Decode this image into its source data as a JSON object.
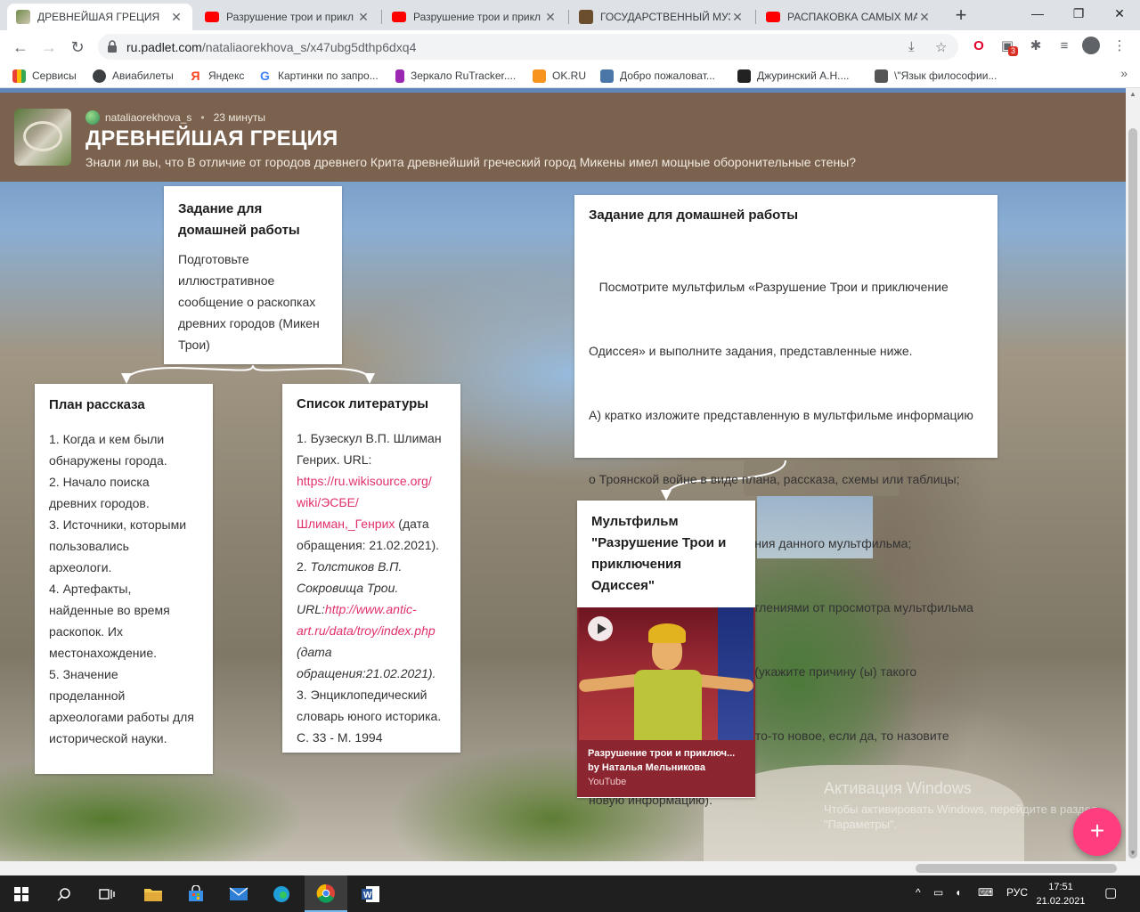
{
  "browser": {
    "tabs": [
      {
        "title": "ДРЕВНЕЙШАЯ ГРЕЦИЯ",
        "favicon": "padlet-thumb-icon",
        "color": "#8a7a5c",
        "active": true
      },
      {
        "title": "Разрушение трои и прикл",
        "favicon": "youtube-icon",
        "color": "#ff0000",
        "active": false
      },
      {
        "title": "Разрушение трои и прикл",
        "favicon": "youtube-icon",
        "color": "#ff0000",
        "active": false
      },
      {
        "title": "ГОСУДАРСТВЕННЫЙ МУЗ",
        "favicon": "museum-icon",
        "color": "#6b4e2e",
        "active": false
      },
      {
        "title": "РАСПАКОВКА САМЫХ МА",
        "favicon": "youtube-icon",
        "color": "#ff0000",
        "active": false
      }
    ],
    "close_glyph": "✕",
    "new_tab_glyph": "+",
    "window_controls": {
      "minimize": "—",
      "restore": "❐",
      "close": "✕"
    },
    "url": {
      "host": "ru.padlet.com",
      "path": "/nataliaorekhova_s/x47ubg5dthp6dxq4"
    },
    "extension_badge": "3",
    "bookmarks": [
      {
        "label": "Сервисы",
        "icon": "apps-grid-icon",
        "color": "#4285f4"
      },
      {
        "label": "Авиабилеты",
        "icon": "globe-icon",
        "color": "#3c4043"
      },
      {
        "label": "Яндекс",
        "icon": "yandex-icon",
        "color": "#fc3f1d"
      },
      {
        "label": "Картинки по запро...",
        "icon": "google-icon",
        "color": "#4285f4"
      },
      {
        "label": "Зеркало RuTracker....",
        "icon": "rutracker-icon",
        "color": "#9c27b0"
      },
      {
        "label": "OK.RU",
        "icon": "ok-icon",
        "color": "#f7931e"
      },
      {
        "label": "Добро пожаловат...",
        "icon": "vk-icon",
        "color": "#4a76a8"
      },
      {
        "label": "Джуринский А.Н....",
        "icon": "blocked-icon",
        "color": "#222222"
      },
      {
        "label": "\\\"Язык философии...",
        "icon": "page-icon",
        "color": "#555555"
      }
    ],
    "bookmarks_more": "»"
  },
  "padlet": {
    "author": "nataliaorekhova_s",
    "separator": "•",
    "time": "23 минуты",
    "title": "ДРЕВНЕЙШАЯ ГРЕЦИЯ",
    "description": "Знали ли вы, что В отличие от городов древнего Крита древнейший греческий город Микены имел мощные оборонительные стены?",
    "accent": "#ff3d7f",
    "header_color": "#7a624e",
    "fab_label": "+"
  },
  "cards": {
    "homework_small": {
      "title_1": "Задание для",
      "title_2": "домашней работы",
      "lines": [
        "Подготовьте",
        "иллюстративное",
        "сообщение о раскопках",
        "древних городов (Микен",
        "Трои)"
      ]
    },
    "plan": {
      "title": "План рассказа",
      "lines": [
        "1. Когда и кем были",
        "обнаружены города.",
        "2. Начало поиска",
        "древних городов.",
        "3. Источники, которыми",
        "пользовались",
        "археологи.",
        "4. Артефакты,",
        "найденные во время",
        "раскопок. Их",
        "местонахождение.",
        "5. Значение",
        "проделанной",
        "археологами работы для",
        "исторической науки."
      ]
    },
    "literature": {
      "title": "Список литературы",
      "l1": "1. Бузескул В.П. Шлиман",
      "l2": "Генрих. URL:",
      "link1_a": "https://ru.wikisource.org/",
      "link1_b": "wiki/ЭСБЕ/",
      "link1_c": "Шлиман,_Генрих",
      "l3_tail": " (дата",
      "l4": "обращения: 21.02.2021).",
      "l5": "2. ",
      "l5_italic": "Толстиков В.П.",
      "l6": "Сокровища Трои.",
      "l7": "URL:",
      "link2_a": "http://www.antic-",
      "link2_b": "art.ru/data/troy/index.php",
      "l8": "(дата",
      "l9": "обращения:21.02.2021).",
      "l10": "3. Энциклопедический",
      "l11": "словарь юного историка.",
      "l12": "С. 33 - М. 1994"
    },
    "homework_big": {
      "title": "Задание для домашней работы",
      "lines": [
        "   Посмотрите мультфильм «Разрушение Трои и приключение",
        "Одиссея» и выполните задания, представленные ниже.",
        "А) кратко изложите представленную в мультфильме информацию",
        "о Троянской войне в виде плана, рассказа, схемы или таблицы;",
        "Б) предположите цель создания данного мультфильма;",
        "В) поделитесь своими впечатлениями от просмотра мультфильма",
        "(понравился он вам или нет (укажите причину (ы) такого",
        "заключения), узнали ли вы что-то новое, если да, то назовите",
        "новую информацию)."
      ]
    },
    "cartoon": {
      "title_1": "Мультфильм",
      "title_2": "\"Разрушение Трои и",
      "title_3": "приключения",
      "title_4": "Одиссея\"",
      "video_title": "Разрушение трои и приключ...",
      "video_author": "by Наталья Мельникова",
      "video_source": "YouTube"
    }
  },
  "watermark": {
    "line1": "Активация Windows",
    "line2": "Чтобы активировать Windows, перейдите в раздел \"Параметры\"."
  },
  "taskbar": {
    "apps": [
      "windows-start-icon",
      "search-icon",
      "task-view-icon",
      "file-explorer-icon",
      "store-icon",
      "mail-icon",
      "edge-icon",
      "chrome-icon",
      "word-icon"
    ],
    "tray_chevron": "^",
    "lang": "РУС",
    "time": "17:51",
    "date": "21.02.2021"
  }
}
